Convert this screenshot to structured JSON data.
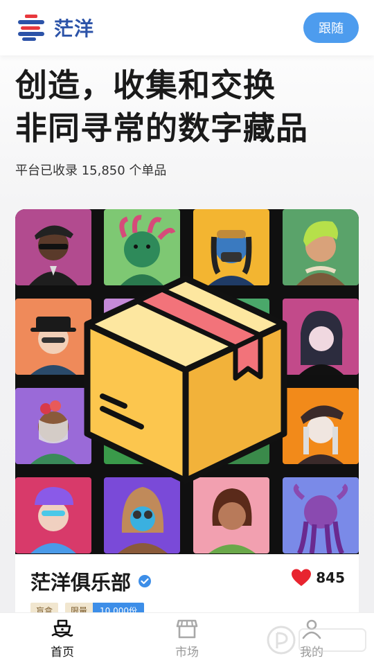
{
  "header": {
    "brand": "茫洋",
    "follow_label": "跟随"
  },
  "hero": {
    "title_line1": "创造，收集和交换",
    "title_line2": "非同寻常的数字藏品",
    "subtitle": "平台已收录 15,850 个单品"
  },
  "card": {
    "collection_name": "茫洋俱乐部",
    "likes": "845",
    "tags": {
      "blind_box": "盲盒",
      "limited": "限量",
      "quantity": "10,000份"
    }
  },
  "nav": {
    "items": [
      {
        "label": "首页"
      },
      {
        "label": "市场"
      },
      {
        "label": "我的"
      }
    ]
  },
  "colors": {
    "accent": "#4d9cee",
    "brand": "#2c53a8",
    "like": "#e8242f"
  },
  "icons": [
    "logo-icon",
    "verified-icon",
    "heart-icon",
    "home-ship-icon",
    "market-store-icon",
    "profile-icon",
    "box-icon"
  ]
}
